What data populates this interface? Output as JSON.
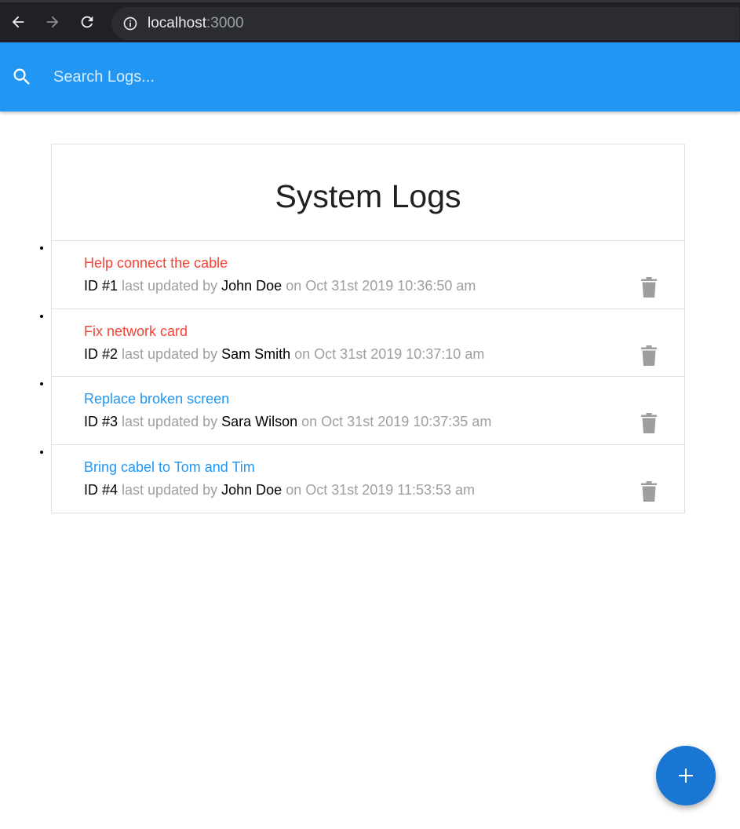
{
  "browser": {
    "url_host": "localhost",
    "url_port": ":3000"
  },
  "search": {
    "placeholder": "Search Logs..."
  },
  "logs": {
    "title": "System Logs",
    "items": [
      {
        "message": "Help connect the cable",
        "attention": true,
        "id_label": "ID #1",
        "updated_label": " last updated by ",
        "tech": "John Doe",
        "date": " on Oct 31st 2019 10:36:50 am"
      },
      {
        "message": "Fix network card",
        "attention": true,
        "id_label": "ID #2",
        "updated_label": " last updated by ",
        "tech": "Sam Smith",
        "date": " on Oct 31st 2019 10:37:10 am"
      },
      {
        "message": "Replace broken screen",
        "attention": false,
        "id_label": "ID #3",
        "updated_label": " last updated by ",
        "tech": "Sara Wilson",
        "date": " on Oct 31st 2019 10:37:35 am"
      },
      {
        "message": "Bring cabel to Tom and Tim",
        "attention": false,
        "id_label": "ID #4",
        "updated_label": " last updated by ",
        "tech": "John Doe",
        "date": " on Oct 31st 2019 11:53:53 am"
      }
    ]
  },
  "colors": {
    "nav_blue": "#2196f3",
    "attention_red": "#f44336",
    "normal_blue": "#2196f3",
    "fab_blue": "#1976d2",
    "trash_grey": "#9e9e9e"
  },
  "icons": {
    "back": "arrow-back-icon",
    "forward": "arrow-forward-icon",
    "reload": "reload-icon",
    "info": "info-icon",
    "search": "search-icon",
    "delete": "trash-icon",
    "add": "plus-icon"
  }
}
